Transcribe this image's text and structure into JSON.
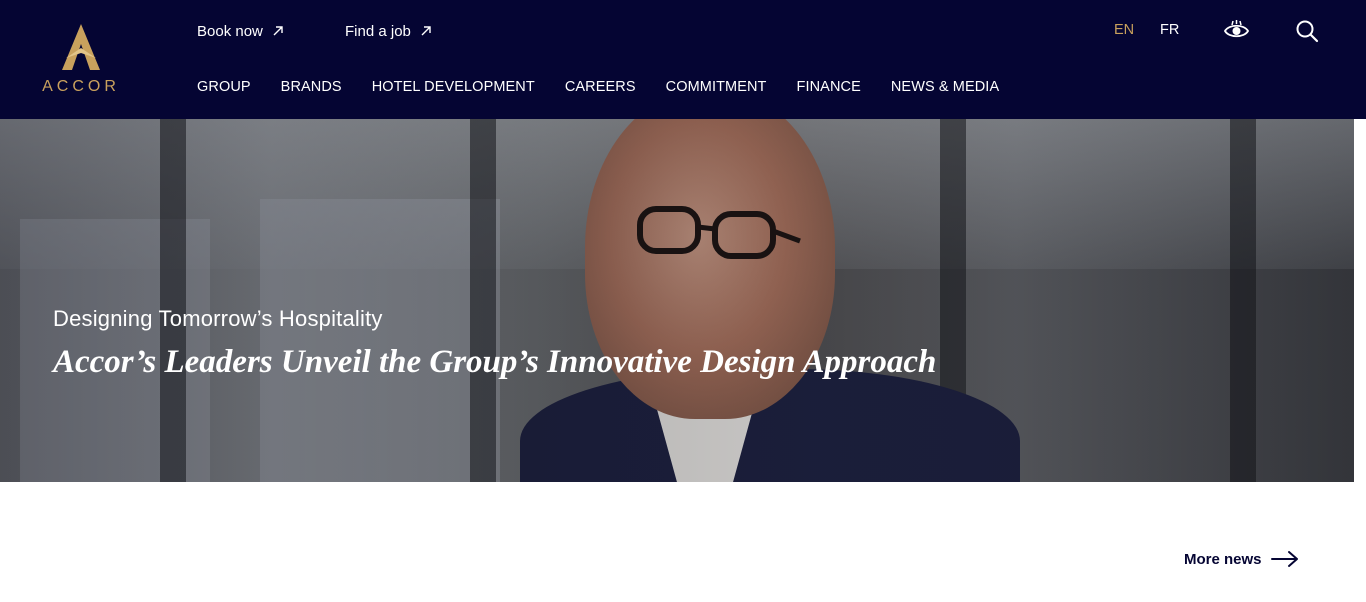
{
  "brand": {
    "wordmark": "ACCOR",
    "accent_color": "#c9a15d",
    "header_bg": "#050533"
  },
  "utility": {
    "book_now": "Book now",
    "find_job": "Find a job",
    "external_icon": "arrow-up-right-icon"
  },
  "nav": {
    "items": [
      "GROUP",
      "BRANDS",
      "HOTEL DEVELOPMENT",
      "CAREERS",
      "COMMITMENT",
      "FINANCE",
      "NEWS & MEDIA"
    ]
  },
  "languages": {
    "en": "EN",
    "fr": "FR",
    "selected": "EN"
  },
  "icons": {
    "accessibility": "eye-icon",
    "search": "search-icon"
  },
  "hero": {
    "subtitle": "Designing Tomorrow’s Hospitality",
    "title": "Accor’s Leaders Unveil the Group’s Innovative Design Approach"
  },
  "news": {
    "more_label": "More news",
    "arrow_icon": "arrow-right-icon"
  }
}
